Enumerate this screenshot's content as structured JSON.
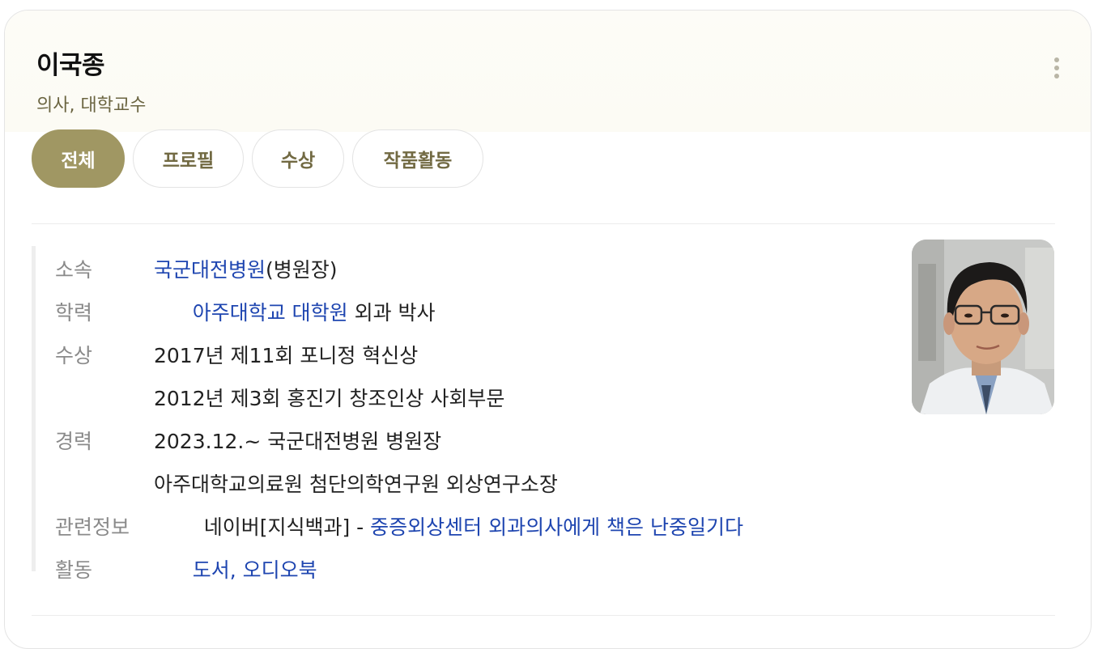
{
  "profile": {
    "name": "이국종",
    "occupation": "의사, 대학교수"
  },
  "tabs": [
    {
      "label": "전체",
      "active": true
    },
    {
      "label": "프로필",
      "active": false
    },
    {
      "label": "수상",
      "active": false
    },
    {
      "label": "작품활동",
      "active": false
    }
  ],
  "info": {
    "affiliation": {
      "label": "소속",
      "link": "국군대전병원",
      "suffix": "(병원장)"
    },
    "education": {
      "label": "학력",
      "link": "아주대학교 대학원",
      "suffix": " 외과 박사"
    },
    "awards": {
      "label": "수상",
      "items": [
        "2017년 제11회 포니정 혁신상",
        "2012년 제3회 홍진기 창조인상 사회부문"
      ]
    },
    "career": {
      "label": "경력",
      "items": [
        "2023.12.~ 국군대전병원 병원장",
        "아주대학교의료원 첨단의학연구원 외상연구소장"
      ]
    },
    "related": {
      "label": "관련정보",
      "source": "네이버[지식백과] - ",
      "link": "중증외상센터 외과의사에게 책은 난중일기다"
    },
    "activity": {
      "label": "활동",
      "link1": "도서",
      "sep": ", ",
      "link2": "오디오북"
    }
  },
  "photo": {
    "icon": "person-photo"
  },
  "colors": {
    "accent": "#a09763",
    "link": "#1e45b0",
    "label": "#8a8a8a"
  }
}
